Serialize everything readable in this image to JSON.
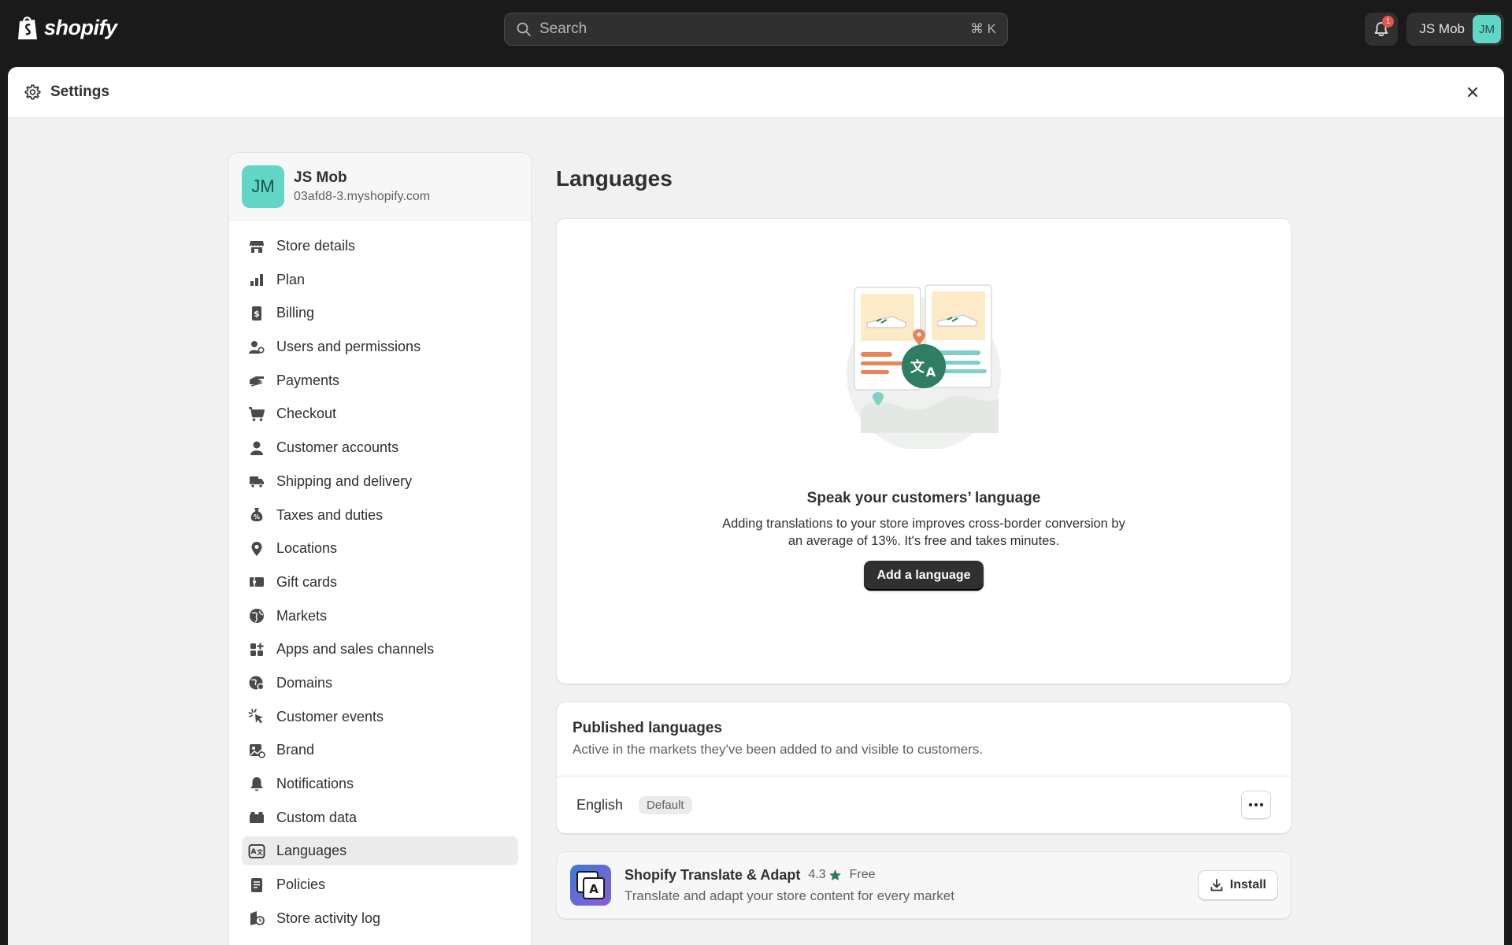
{
  "topbar": {
    "logo_text": "shopify",
    "search_placeholder": "Search",
    "search_shortcut": "⌘ K",
    "notification_count": "1",
    "account_name": "JS Mob",
    "account_initials": "JM"
  },
  "modal": {
    "title": "Settings"
  },
  "sidebar": {
    "store_initials": "JM",
    "store_name": "JS Mob",
    "store_domain": "03afd8-3.myshopify.com",
    "items": [
      {
        "label": "Store details",
        "icon": "store-icon"
      },
      {
        "label": "Plan",
        "icon": "plan-icon"
      },
      {
        "label": "Billing",
        "icon": "billing-icon"
      },
      {
        "label": "Users and permissions",
        "icon": "users-icon"
      },
      {
        "label": "Payments",
        "icon": "payments-icon"
      },
      {
        "label": "Checkout",
        "icon": "cart-icon"
      },
      {
        "label": "Customer accounts",
        "icon": "person-icon"
      },
      {
        "label": "Shipping and delivery",
        "icon": "truck-icon"
      },
      {
        "label": "Taxes and duties",
        "icon": "tax-icon"
      },
      {
        "label": "Locations",
        "icon": "location-pin-icon"
      },
      {
        "label": "Gift cards",
        "icon": "gift-card-icon"
      },
      {
        "label": "Markets",
        "icon": "globe-icon"
      },
      {
        "label": "Apps and sales channels",
        "icon": "apps-icon"
      },
      {
        "label": "Domains",
        "icon": "domain-globe-icon"
      },
      {
        "label": "Customer events",
        "icon": "cursor-click-icon"
      },
      {
        "label": "Brand",
        "icon": "brand-icon"
      },
      {
        "label": "Notifications",
        "icon": "bell-icon"
      },
      {
        "label": "Custom data",
        "icon": "database-icon"
      },
      {
        "label": "Languages",
        "icon": "translate-icon",
        "active": true
      },
      {
        "label": "Policies",
        "icon": "policy-icon"
      },
      {
        "label": "Store activity log",
        "icon": "activity-log-icon"
      }
    ]
  },
  "main": {
    "title": "Languages",
    "hero": {
      "title": "Speak your customers’ language",
      "text": "Adding translations to your store improves cross-border conversion by an average of 13%. It's free and takes minutes.",
      "button_label": "Add a language"
    },
    "published": {
      "title": "Published languages",
      "subtitle": "Active in the markets they've been added to and visible to customers.",
      "language": "English",
      "badge": "Default"
    },
    "app": {
      "name": "Shopify Translate & Adapt",
      "rating": "4.3",
      "price": "Free",
      "description": "Translate and adapt your store content for every market",
      "install_label": "Install"
    }
  },
  "colors": {
    "topbar_bg": "#1a1a1a",
    "avatar_bg": "#62d6c6",
    "primary_button": "#303030",
    "illustration_green": "#2f7d62",
    "illustration_orange": "#e8845a",
    "rating_star": "#2f7d62"
  }
}
